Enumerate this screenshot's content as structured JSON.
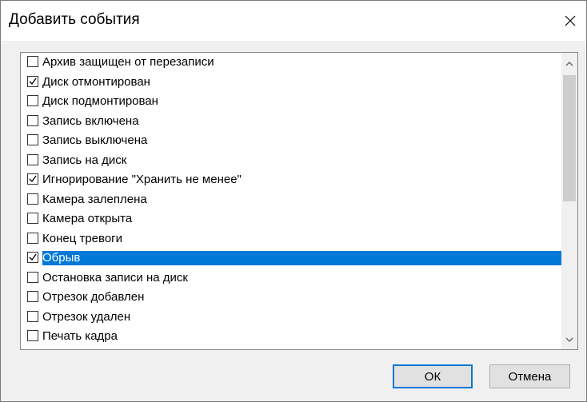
{
  "dialog": {
    "title": "Добавить события",
    "close_icon": "close-icon"
  },
  "events": [
    {
      "label": "Архив защищен от перезаписи",
      "checked": false,
      "selected": false
    },
    {
      "label": "Диск отмонтирован",
      "checked": true,
      "selected": false
    },
    {
      "label": "Диск подмонтирован",
      "checked": false,
      "selected": false
    },
    {
      "label": "Запись включена",
      "checked": false,
      "selected": false
    },
    {
      "label": "Запись выключена",
      "checked": false,
      "selected": false
    },
    {
      "label": "Запись на диск",
      "checked": false,
      "selected": false
    },
    {
      "label": "Игнорирование \"Хранить не менее\"",
      "checked": true,
      "selected": false
    },
    {
      "label": "Камера залеплена",
      "checked": false,
      "selected": false
    },
    {
      "label": "Камера открыта",
      "checked": false,
      "selected": false
    },
    {
      "label": "Конец тревоги",
      "checked": false,
      "selected": false
    },
    {
      "label": "Обрыв",
      "checked": true,
      "selected": true
    },
    {
      "label": "Остановка записи на диск",
      "checked": false,
      "selected": false
    },
    {
      "label": "Отрезок добавлен",
      "checked": false,
      "selected": false
    },
    {
      "label": "Отрезок удален",
      "checked": false,
      "selected": false
    },
    {
      "label": "Печать кадра",
      "checked": false,
      "selected": false
    }
  ],
  "buttons": {
    "ok_label": "ОК",
    "cancel_label": "Отмена"
  },
  "colors": {
    "selection": "#0078d7",
    "dialog_background": "#f0f0f0"
  }
}
